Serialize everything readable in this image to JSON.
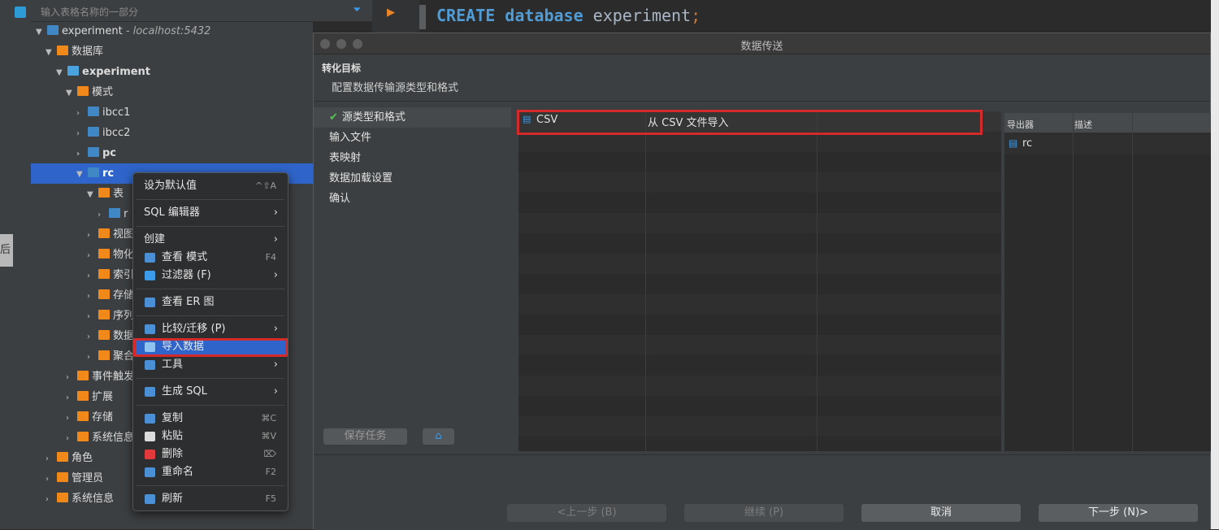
{
  "sidebar": {
    "filter_placeholder": "输入表格名称的一部分",
    "left_partial_text": "后的"
  },
  "tree": {
    "connection": "experiment",
    "connection_host": "- localhost:5432",
    "databases": "数据库",
    "db_experiment": "experiment",
    "schemas": "模式",
    "schema1": "ibcc1",
    "schema2": "ibcc2",
    "schema3": "pc",
    "schema4": "rc",
    "tables": "表",
    "table_partial": "r",
    "views": "视图",
    "matviews": "物化",
    "indexes": "索引",
    "storage": "存储",
    "sequences": "序列",
    "datatypes": "数据",
    "aggregates": "聚合",
    "event_triggers": "事件触发",
    "extensions": "扩展",
    "storage2": "存储",
    "sysinfo": "系统信息",
    "roles": "角色",
    "admins": "管理员",
    "sysinfo2": "系统信息"
  },
  "editor": {
    "kw1": "CREATE",
    "kw2": "database",
    "ident": "experiment",
    "semi": ";"
  },
  "context_menu": {
    "set_default": "设为默认值",
    "set_default_sc": "^⇧A",
    "sql_editor": "SQL 编辑器",
    "create": "创建",
    "view_schema": "查看 模式",
    "view_schema_sc": "F4",
    "filter": "过滤器 (F)",
    "view_er": "查看 ER 图",
    "compare": "比较/迁移 (P)",
    "import": "导入数据",
    "tools": "工具",
    "gen_sql": "生成 SQL",
    "copy": "复制",
    "copy_sc": "⌘C",
    "paste": "粘贴",
    "paste_sc": "⌘V",
    "delete": "删除",
    "delete_sc": "⌦",
    "rename": "重命名",
    "rename_sc": "F2",
    "refresh": "刷新",
    "refresh_sc": "F5"
  },
  "dialog": {
    "title": "数据传送",
    "header_title": "转化目标",
    "header_desc": "配置数据传输源类型和格式",
    "steps": [
      "源类型和格式",
      "输入文件",
      "表映射",
      "数据加载设置",
      "确认"
    ],
    "save_task": "保存任务",
    "grid_row": {
      "name": "CSV",
      "desc": "从 CSV 文件导入"
    },
    "exp_headers": [
      "导出器",
      "描述"
    ],
    "exp_row": "rc",
    "buttons": {
      "back": "<上一步 (B)",
      "continue": "继续 (P)",
      "cancel": "取消",
      "next": "下一步 (N)>"
    }
  }
}
